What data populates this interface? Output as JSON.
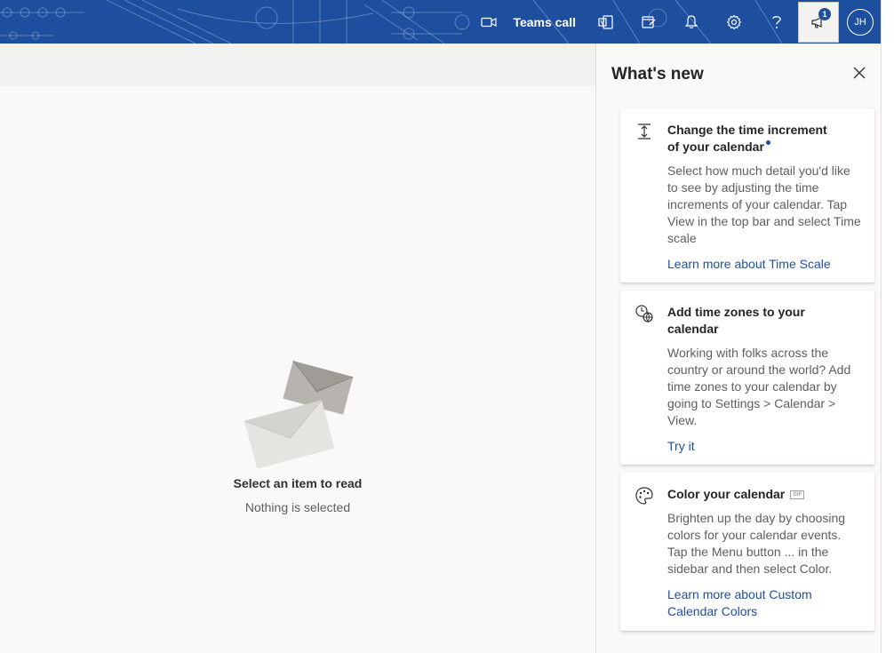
{
  "topbar": {
    "teams_call_label": "Teams call",
    "notification_count": "1",
    "avatar_initials": "JH",
    "background_color": "#1e4f9f",
    "icons": [
      "video-camera-icon",
      "office-icon",
      "my-day-icon",
      "bell-icon",
      "gear-icon",
      "help-icon",
      "megaphone-icon"
    ]
  },
  "reading_pane": {
    "empty_title": "Select an item to read",
    "empty_subtitle": "Nothing is selected"
  },
  "whats_new": {
    "title": "What's new",
    "cards": [
      {
        "icon": "time-scale-icon",
        "title_line1": "Change the time increment",
        "title_line2": "of your calendar",
        "body": "Select how much detail you'd like to see by adjusting the time increments of your calendar. Tap View in the top bar and select Time scale",
        "link": "Learn more about Time Scale"
      },
      {
        "icon": "globe-clock-icon",
        "title": "Add time zones to your calendar",
        "body": "Working with folks across the country or around the world? Add time zones to your calendar by going to Settings > Calendar > View.",
        "link": "Try it"
      },
      {
        "icon": "palette-icon",
        "title": "Color your calendar",
        "badge": "GIF",
        "body": "Brighten up the day by choosing colors for your calendar events. Tap the Menu button ... in the sidebar and then select Color.",
        "link": "Learn more about Custom Calendar Colors"
      }
    ]
  },
  "colors": {
    "accent": "#1e4f9f",
    "link": "#1e4f9f",
    "text_secondary": "#605e5c"
  }
}
